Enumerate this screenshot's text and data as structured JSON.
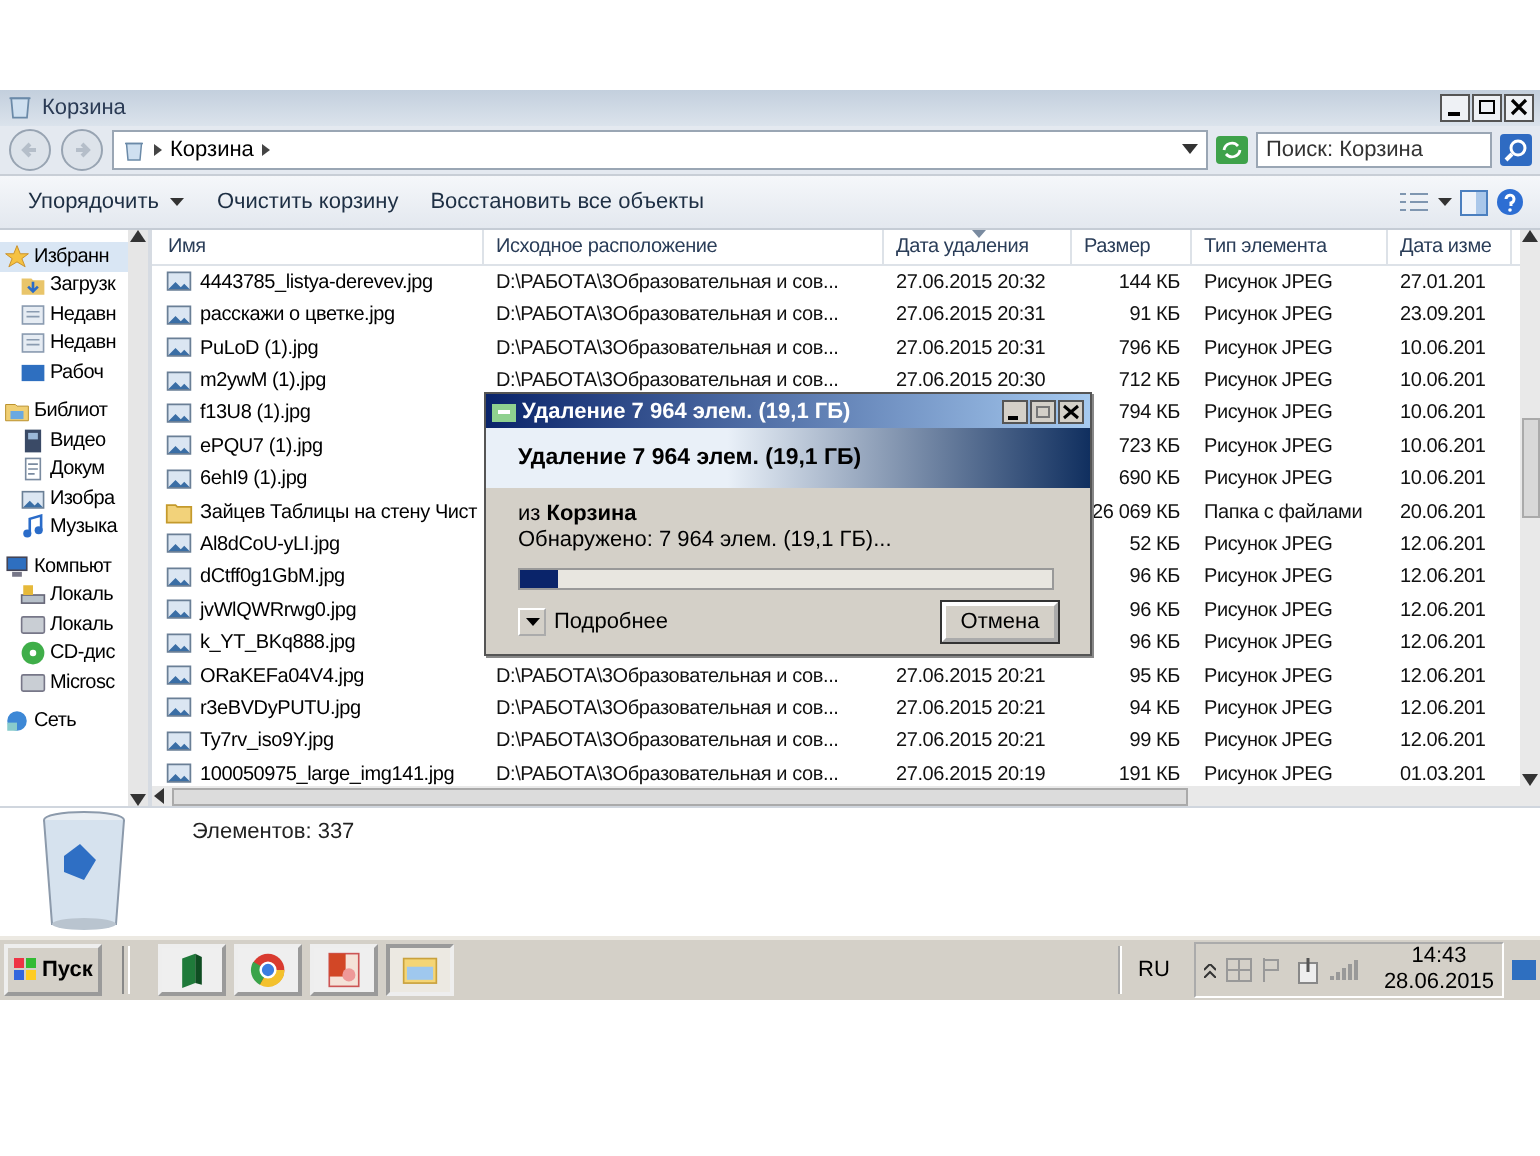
{
  "window": {
    "title": "Корзина"
  },
  "address": {
    "crumb": "Корзина"
  },
  "search": {
    "placeholder": "Поиск: Корзина"
  },
  "toolbar": {
    "buttons": [
      {
        "label": "Упорядочить",
        "dropdown": true
      },
      {
        "label": "Очистить корзину",
        "dropdown": false
      },
      {
        "label": "Восстановить все объекты",
        "dropdown": false
      }
    ]
  },
  "sidebar": {
    "items": [
      {
        "label": "Избранн",
        "kind": "star",
        "selected": true,
        "children": [
          {
            "label": "Загрузк",
            "kind": "download",
            "selected": false
          },
          {
            "label": "Недавн",
            "kind": "recent",
            "selected": false
          },
          {
            "label": "Недавн",
            "kind": "recent",
            "selected": false
          },
          {
            "label": "Рабоч",
            "kind": "desktop",
            "selected": false
          }
        ]
      },
      {
        "label": "Библиот",
        "kind": "library",
        "selected": false,
        "children": [
          {
            "label": "Видео",
            "kind": "video",
            "selected": false
          },
          {
            "label": "Докум",
            "kind": "document",
            "selected": false
          },
          {
            "label": "Изобра",
            "kind": "picture",
            "selected": false
          },
          {
            "label": "Музыка",
            "kind": "music",
            "selected": false
          }
        ]
      },
      {
        "label": "Компьют",
        "kind": "computer",
        "selected": false,
        "children": [
          {
            "label": "Локаль",
            "kind": "system-drive",
            "selected": false
          },
          {
            "label": "Локаль",
            "kind": "drive",
            "selected": false
          },
          {
            "label": "CD-дис",
            "kind": "cd",
            "selected": false
          },
          {
            "label": "Microsc",
            "kind": "drive",
            "selected": false
          }
        ]
      },
      {
        "label": "Сеть",
        "kind": "network",
        "selected": false
      }
    ]
  },
  "table": {
    "columns": [
      {
        "label": "Имя",
        "sorted": false
      },
      {
        "label": "Исходное расположение",
        "sorted": false
      },
      {
        "label": "Дата удаления",
        "sorted": true
      },
      {
        "label": "Размер",
        "sorted": false
      },
      {
        "label": "Тип элемента",
        "sorted": false
      },
      {
        "label": "Дата изме",
        "sorted": false
      }
    ],
    "rows": [
      {
        "kind": "image",
        "name": "4443785_listya-derevev.jpg",
        "location": "D:\\РАБОТА\\3Образовательная и сов...",
        "deleted": "27.06.2015 20:32",
        "size": "144 КБ",
        "type": "Рисунок JPEG",
        "modified": "27.01.201"
      },
      {
        "kind": "image",
        "name": "расскажи о цветке.jpg",
        "location": "D:\\РАБОТА\\3Образовательная и сов...",
        "deleted": "27.06.2015 20:31",
        "size": "91 КБ",
        "type": "Рисунок JPEG",
        "modified": "23.09.201"
      },
      {
        "kind": "image",
        "name": "PuLoD (1).jpg",
        "location": "D:\\РАБОТА\\3Образовательная и сов...",
        "deleted": "27.06.2015 20:31",
        "size": "796 КБ",
        "type": "Рисунок JPEG",
        "modified": "10.06.201"
      },
      {
        "kind": "image",
        "name": "m2ywM (1).jpg",
        "location": "D:\\РАБОТА\\3Образовательная и сов...",
        "deleted": "27.06.2015 20:30",
        "size": "712 КБ",
        "type": "Рисунок JPEG",
        "modified": "10.06.201"
      },
      {
        "kind": "image",
        "name": "f13U8 (1).jpg",
        "size": "794 КБ",
        "type": "Рисунок JPEG",
        "modified": "10.06.201"
      },
      {
        "kind": "image",
        "name": "ePQU7 (1).jpg",
        "size": "723 КБ",
        "type": "Рисунок JPEG",
        "modified": "10.06.201"
      },
      {
        "kind": "image",
        "name": "6ehI9 (1).jpg",
        "size": "690 КБ",
        "type": "Рисунок JPEG",
        "modified": "10.06.201"
      },
      {
        "kind": "folder",
        "name": "Зайцев Таблицы на стену Чист",
        "size": "26 069 КБ",
        "type": "Папка с файлами",
        "modified": "20.06.201"
      },
      {
        "kind": "image",
        "name": "Al8dCoU-yLI.jpg",
        "size": "52 КБ",
        "type": "Рисунок JPEG",
        "modified": "12.06.201"
      },
      {
        "kind": "image",
        "name": "dCtff0g1GbM.jpg",
        "size": "96 КБ",
        "type": "Рисунок JPEG",
        "modified": "12.06.201"
      },
      {
        "kind": "image",
        "name": "jvWlQWRrwg0.jpg",
        "size": "96 КБ",
        "type": "Рисунок JPEG",
        "modified": "12.06.201"
      },
      {
        "kind": "image",
        "name": "k_YT_BKq888.jpg",
        "size": "96 КБ",
        "type": "Рисунок JPEG",
        "modified": "12.06.201"
      },
      {
        "kind": "image",
        "name": "ORaKEFa04V4.jpg",
        "location": "D:\\РАБОТА\\3Образовательная и сов...",
        "deleted": "27.06.2015 20:21",
        "size": "95 КБ",
        "type": "Рисунок JPEG",
        "modified": "12.06.201"
      },
      {
        "kind": "image",
        "name": "r3eBVDyPUTU.jpg",
        "location": "D:\\РАБОТА\\3Образовательная и сов...",
        "deleted": "27.06.2015 20:21",
        "size": "94 КБ",
        "type": "Рисунок JPEG",
        "modified": "12.06.201"
      },
      {
        "kind": "image",
        "name": "Ty7rv_iso9Y.jpg",
        "location": "D:\\РАБОТА\\3Образовательная и сов...",
        "deleted": "27.06.2015 20:21",
        "size": "99 КБ",
        "type": "Рисунок JPEG",
        "modified": "12.06.201"
      },
      {
        "kind": "image",
        "name": "100050975_large_img141.jpg",
        "location": "D:\\РАБОТА\\3Образовательная и сов...",
        "deleted": "27.06.2015 20:19",
        "size": "191 КБ",
        "type": "Рисунок JPEG",
        "modified": "01.03.201"
      }
    ]
  },
  "details": {
    "count": "Элементов: 337"
  },
  "dialog": {
    "title": "Удаление 7 964 элем. (19,1 ГБ)",
    "heading": "Удаление 7 964 элем. (19,1 ГБ)",
    "source": "из **Корзина**",
    "found": "Обнаружено: 7 964 элем. (19,1 ГБ)...",
    "level": 0.07,
    "details_label": "Подробнее",
    "cancel": "Отмена"
  },
  "taskbar": {
    "start": "Пуск",
    "apps": [
      {
        "kind": "book",
        "active": false
      },
      {
        "kind": "browser",
        "active": false
      },
      {
        "kind": "slides",
        "active": false
      },
      {
        "kind": "explorer",
        "active": true
      }
    ],
    "language": "RU",
    "time": "14:43",
    "date": "28.06.2015"
  }
}
